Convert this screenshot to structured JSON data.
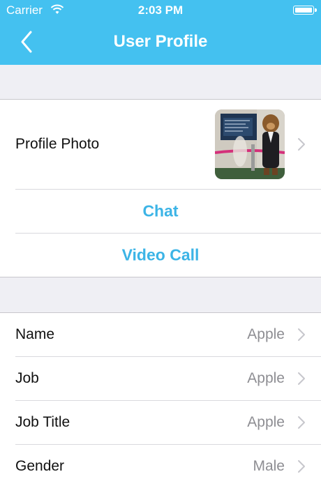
{
  "status_bar": {
    "carrier": "Carrier",
    "time": "2:03 PM"
  },
  "nav": {
    "title": "User Profile"
  },
  "profile": {
    "photo_label": "Profile Photo",
    "chat_label": "Chat",
    "video_call_label": "Video Call"
  },
  "details": [
    {
      "label": "Name",
      "value": "Apple"
    },
    {
      "label": "Job",
      "value": "Apple"
    },
    {
      "label": "Job Title",
      "value": "Apple"
    },
    {
      "label": "Gender",
      "value": "Male"
    }
  ],
  "colors": {
    "accent": "#44c1f0",
    "action_text": "#3cb4e6",
    "background": "#efeff4"
  }
}
